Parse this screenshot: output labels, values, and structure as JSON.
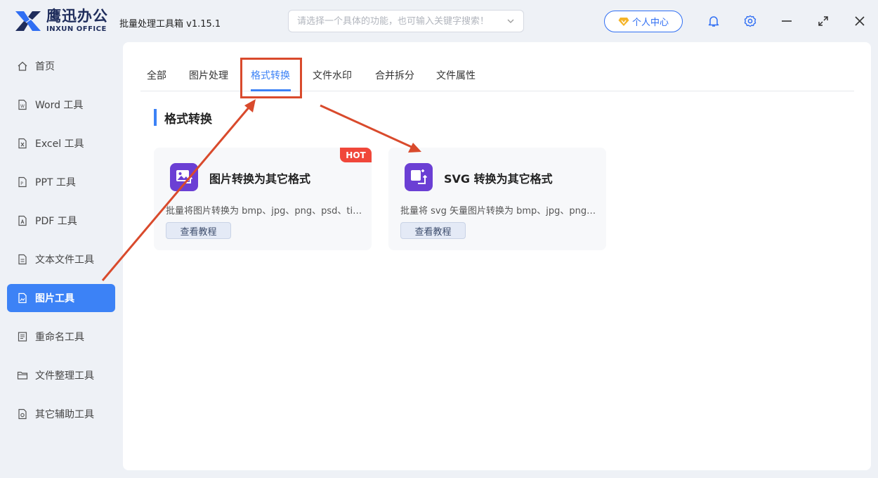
{
  "app": {
    "logo_cn": "鹰迅办公",
    "logo_en": "INXUN OFFICE",
    "title": "批量处理工具箱 v1.15.1"
  },
  "search": {
    "placeholder": "请选择一个具体的功能，也可输入关键字搜索！"
  },
  "header": {
    "user_center": "个人中心"
  },
  "sidebar": {
    "items": [
      {
        "label": "首页",
        "icon": "home-icon"
      },
      {
        "label": "Word 工具",
        "icon": "word-file-icon"
      },
      {
        "label": "Excel 工具",
        "icon": "excel-file-icon"
      },
      {
        "label": "PPT 工具",
        "icon": "ppt-file-icon"
      },
      {
        "label": "PDF 工具",
        "icon": "pdf-file-icon"
      },
      {
        "label": "文本文件工具",
        "icon": "text-file-icon"
      },
      {
        "label": "图片工具",
        "icon": "image-file-icon",
        "active": true
      },
      {
        "label": "重命名工具",
        "icon": "rename-icon"
      },
      {
        "label": "文件整理工具",
        "icon": "folder-icon"
      },
      {
        "label": "其它辅助工具",
        "icon": "tools-icon"
      }
    ]
  },
  "tabs": [
    {
      "label": "全部"
    },
    {
      "label": "图片处理"
    },
    {
      "label": "格式转换",
      "active": true
    },
    {
      "label": "文件水印"
    },
    {
      "label": "合并拆分"
    },
    {
      "label": "文件属性"
    }
  ],
  "section": {
    "title": "格式转换"
  },
  "cards": [
    {
      "title": "图片转换为其它格式",
      "desc": "批量将图片转换为 bmp、jpg、png、psd、tif、gif 等格式",
      "button": "查看教程",
      "badge": "HOT"
    },
    {
      "title": "SVG 转换为其它格式",
      "desc": "批量将 svg 矢量图片转换为 bmp、jpg、png、pdf 等格式",
      "button": "查看教程"
    }
  ],
  "colors": {
    "accent": "#3c82f6",
    "annotation": "#d94a2c",
    "card_icon": "#6b3fd4",
    "hot": "#f0473a"
  }
}
